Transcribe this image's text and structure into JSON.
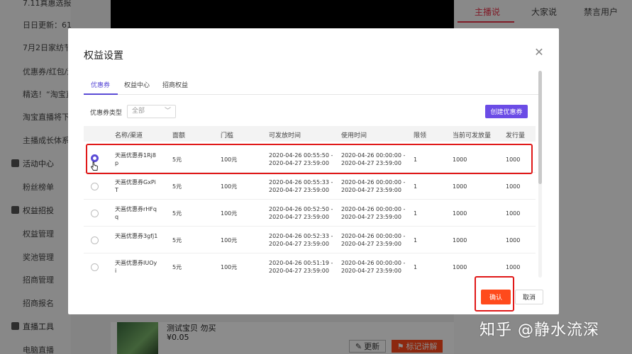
{
  "sidebar": {
    "items": [
      {
        "label": "7.11真惠选报名中",
        "kind": "sub"
      },
      {
        "label": "日日更新：618活动规则",
        "kind": "sub"
      },
      {
        "label": "7月2日家纺节报",
        "kind": "sub"
      },
      {
        "label": "优惠券/红包/淘",
        "kind": "sub"
      },
      {
        "label": "精选！“淘宝直播",
        "kind": "sub"
      },
      {
        "label": "淘宝直播将下线",
        "kind": "sub"
      },
      {
        "label": "主播成长体系说",
        "kind": "sub"
      },
      {
        "label": "活动中心",
        "kind": "group"
      },
      {
        "label": "粉丝榜单",
        "kind": "sub"
      },
      {
        "label": "权益招投",
        "kind": "group"
      },
      {
        "label": "权益管理",
        "kind": "sub"
      },
      {
        "label": "奖池管理",
        "kind": "sub"
      },
      {
        "label": "招商管理",
        "kind": "sub"
      },
      {
        "label": "招商报名",
        "kind": "sub"
      },
      {
        "label": "直播工具",
        "kind": "group"
      },
      {
        "label": "电脑直播",
        "kind": "sub"
      }
    ]
  },
  "right_panel": {
    "tabs": [
      {
        "label": "主播说",
        "active": true
      },
      {
        "label": "大家说",
        "active": false
      },
      {
        "label": "禁言用户",
        "active": false
      }
    ]
  },
  "product": {
    "title": "测试宝贝 勿买",
    "price": "¥0.05",
    "refresh_label": "更新",
    "mark_label": "标记讲解"
  },
  "modal": {
    "title": "权益设置",
    "tabs": [
      {
        "label": "优惠券",
        "active": true
      },
      {
        "label": "权益中心",
        "active": false
      },
      {
        "label": "招商权益",
        "active": false
      }
    ],
    "filter": {
      "label": "优惠券类型",
      "selected": "全部"
    },
    "create_button": "创建优惠券",
    "columns": [
      "名称/渠道",
      "面额",
      "门槛",
      "可发放时间",
      "使用时间",
      "限领",
      "当前可发放量",
      "发行量"
    ],
    "rows": [
      {
        "name1": "天画优惠券1Rj8",
        "name2": "p",
        "amount": "5元",
        "threshold": "100元",
        "issue1": "2020-04-26 00:55:50 -",
        "issue2": "2020-04-27 23:59:00",
        "use1": "2020-04-26 00:00:00 -",
        "use2": "2020-04-27 23:59:00",
        "limit": "1",
        "available": "1000",
        "total": "1000",
        "selected": true
      },
      {
        "name1": "天画优惠券GxPi",
        "name2": "T",
        "amount": "5元",
        "threshold": "100元",
        "issue1": "2020-04-26 00:55:33 -",
        "issue2": "2020-04-27 23:59:00",
        "use1": "2020-04-26 00:00:00 -",
        "use2": "2020-04-27 23:59:00",
        "limit": "1",
        "available": "1000",
        "total": "1000",
        "selected": false
      },
      {
        "name1": "天画优惠券rHFq",
        "name2": "q",
        "amount": "5元",
        "threshold": "100元",
        "issue1": "2020-04-26 00:52:50 -",
        "issue2": "2020-04-27 23:59:00",
        "use1": "2020-04-26 00:00:00 -",
        "use2": "2020-04-27 23:59:00",
        "limit": "1",
        "available": "1000",
        "total": "1000",
        "selected": false
      },
      {
        "name1": "天画优惠券3gfj1",
        "name2": "",
        "amount": "5元",
        "threshold": "100元",
        "issue1": "2020-04-26 00:52:33 -",
        "issue2": "2020-04-27 23:59:00",
        "use1": "2020-04-26 00:00:00 -",
        "use2": "2020-04-27 23:59:00",
        "limit": "1",
        "available": "1000",
        "total": "1000",
        "selected": false
      },
      {
        "name1": "天画优惠券IUOy",
        "name2": "i",
        "amount": "5元",
        "threshold": "100元",
        "issue1": "2020-04-26 00:51:19 -",
        "issue2": "2020-04-27 23:59:00",
        "use1": "2020-04-26 00:00:00 -",
        "use2": "2020-04-27 23:59:00",
        "limit": "1",
        "available": "1000",
        "total": "1000",
        "selected": false
      }
    ],
    "confirm_button": "确认",
    "cancel_button": "取消"
  },
  "watermark": "知乎 @静水流深",
  "colors": {
    "accent": "#5a4bd6",
    "primary_button": "#ff4a1c",
    "highlight_box": "#e01818",
    "tab_active": "#e8334a"
  }
}
